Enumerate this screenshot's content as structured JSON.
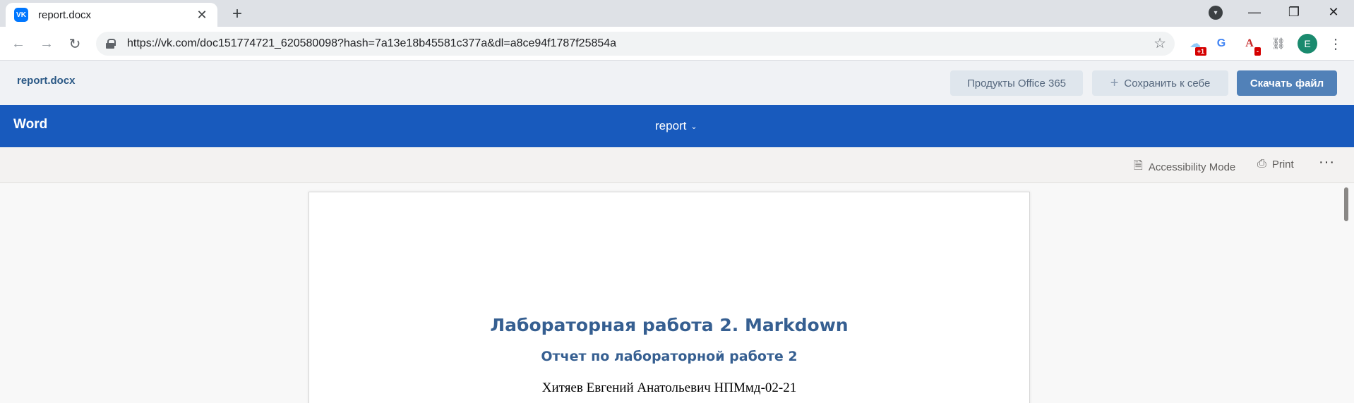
{
  "browser": {
    "tab_title": "report.docx",
    "tab_favicon": "VK",
    "tab_close": "✕",
    "new_tab": "+",
    "url": "https://vk.com/doc151774721_620580098?hash=7a13e18b45581c377a&dl=a8ce94f1787f25854a",
    "extension_badge_1": "+1",
    "extension_badge_3": "-",
    "profile_initial": "E"
  },
  "vk": {
    "doc_name": "report.docx",
    "office_button": "Продукты Office 365",
    "save_button": "Сохранить к себе",
    "download_button": "Скачать файл",
    "accent_color": "#5181b8"
  },
  "word": {
    "app_name": "Word",
    "doc_title": "report",
    "accessibility_label": "Accessibility Mode",
    "print_label": "Print",
    "more_label": "···",
    "brand_color": "#185abd"
  },
  "document": {
    "heading": "Лабораторная работа 2. Markdown",
    "subheading": "Отчет по лабораторной работе 2",
    "author_line": "Хитяев Евгений Анатольевич НПМмд-02-21",
    "heading_color": "#365f91"
  }
}
